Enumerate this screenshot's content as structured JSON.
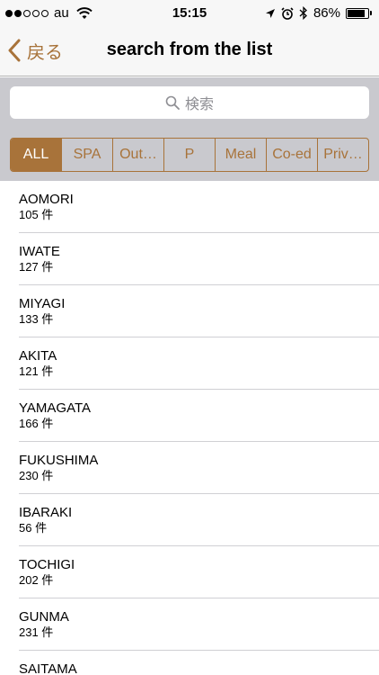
{
  "status_bar": {
    "carrier": "au",
    "time": "15:15",
    "battery": "86%",
    "battery_level": 0.86,
    "signal_bars_filled": 2,
    "signal_bars_total": 5
  },
  "nav": {
    "back_label": "戻る",
    "title": "search from the list"
  },
  "search": {
    "placeholder": "検索"
  },
  "segments": [
    {
      "label": "ALL",
      "selected": true
    },
    {
      "label": "SPA",
      "selected": false
    },
    {
      "label": "Out…",
      "selected": false
    },
    {
      "label": "P",
      "selected": false
    },
    {
      "label": "Meal",
      "selected": false
    },
    {
      "label": "Co-ed",
      "selected": false
    },
    {
      "label": "Priv…",
      "selected": false
    }
  ],
  "list": {
    "items": [
      {
        "name": "AOMORI",
        "count": "105 件"
      },
      {
        "name": "IWATE",
        "count": "127 件"
      },
      {
        "name": "MIYAGI",
        "count": "133 件"
      },
      {
        "name": "AKITA",
        "count": "121 件"
      },
      {
        "name": "YAMAGATA",
        "count": "166 件"
      },
      {
        "name": "FUKUSHIMA",
        "count": "230 件"
      },
      {
        "name": "IBARAKI",
        "count": "56 件"
      },
      {
        "name": "TOCHIGI",
        "count": "202 件"
      },
      {
        "name": "GUNMA",
        "count": "231 件"
      },
      {
        "name": "SAITAMA",
        "count": ""
      }
    ]
  },
  "colors": {
    "accent": "#a8733a",
    "search_bg": "#c9c9ce",
    "bar_bg": "#f7f7f7"
  }
}
